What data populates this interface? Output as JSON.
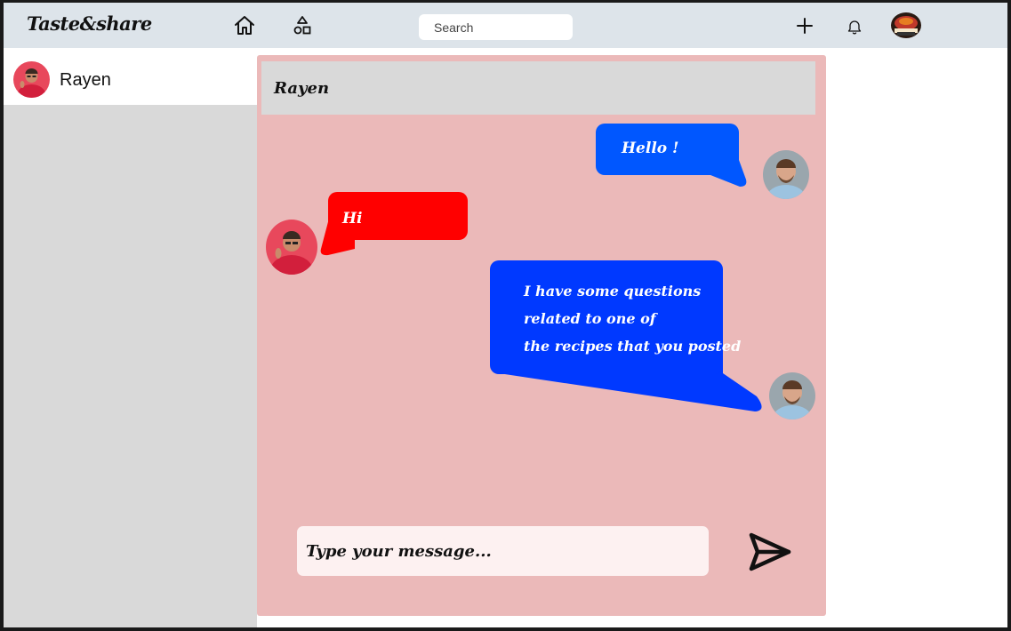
{
  "app": {
    "logo": "Taste&share"
  },
  "topbar": {
    "search_placeholder": "Search",
    "icons": [
      "home-icon",
      "categories-icon",
      "plus-icon",
      "bell-icon"
    ]
  },
  "sidebar": {
    "contacts": [
      {
        "name": "Rayen"
      }
    ]
  },
  "chat": {
    "title": "Rayen",
    "messages": [
      {
        "from": "me",
        "lines": [
          "Hello !"
        ]
      },
      {
        "from": "Rayen",
        "lines": [
          "Hi"
        ]
      },
      {
        "from": "me",
        "lines": [
          "I have some questions",
          "related to one of",
          "the recipes that you posted"
        ]
      }
    ],
    "composer_placeholder": "Type your message..."
  },
  "colors": {
    "topbar": "#dde4ea",
    "sidebar": "#d9d9d9",
    "chat_background": "#ebb9b9",
    "bubble_me_1": "#0057ff",
    "bubble_me_2": "#0039ff",
    "bubble_other": "#ff0000"
  }
}
